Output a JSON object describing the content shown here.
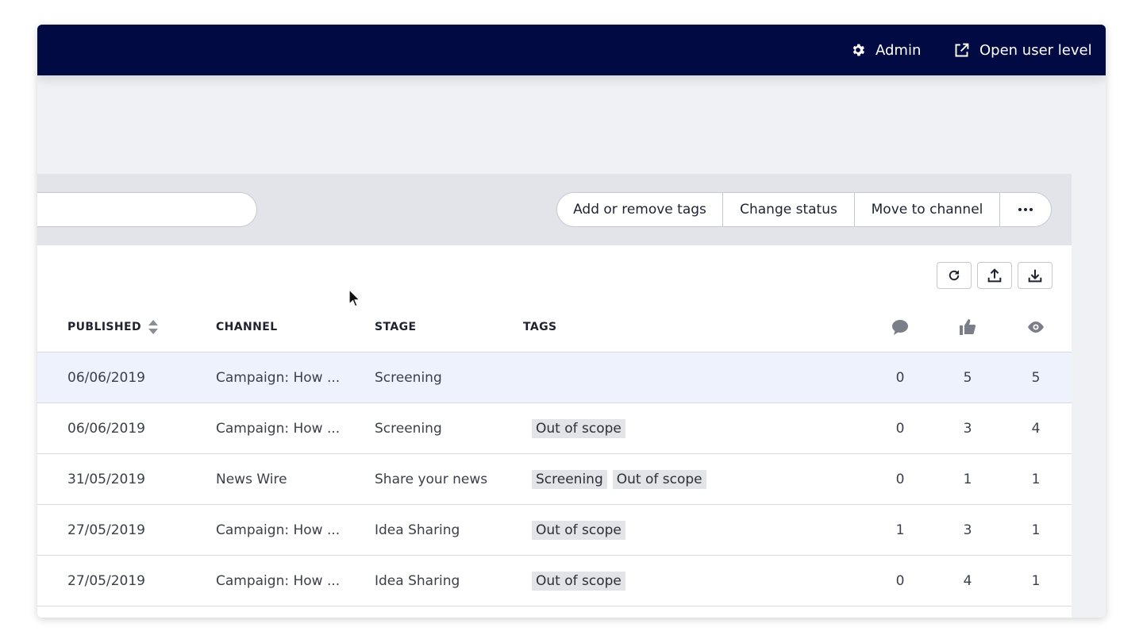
{
  "header": {
    "admin_label": "Admin",
    "open_label": "Open user level"
  },
  "toolbar": {
    "search_placeholder": "",
    "actions": [
      "Add or remove tags",
      "Change status",
      "Move to channel"
    ]
  },
  "table": {
    "columns": {
      "published": "PUBLISHED",
      "channel": "CHANNEL",
      "stage": "STAGE",
      "tags": "TAGS"
    },
    "rows": [
      {
        "date": "06/06/2019",
        "channel": "Campaign: How ...",
        "stage": "Screening",
        "tags": [],
        "comments": "0",
        "likes": "5",
        "views": "5"
      },
      {
        "date": "06/06/2019",
        "channel": "Campaign: How ...",
        "stage": "Screening",
        "tags": [
          "Out of scope"
        ],
        "comments": "0",
        "likes": "3",
        "views": "4"
      },
      {
        "date": "31/05/2019",
        "channel": "News Wire",
        "stage": "Share your news",
        "tags": [
          "Screening",
          "Out of scope"
        ],
        "comments": "0",
        "likes": "1",
        "views": "1"
      },
      {
        "date": "27/05/2019",
        "channel": "Campaign: How ...",
        "stage": "Idea Sharing",
        "tags": [
          "Out of scope"
        ],
        "comments": "1",
        "likes": "3",
        "views": "1"
      },
      {
        "date": "27/05/2019",
        "channel": "Campaign: How ...",
        "stage": "Idea Sharing",
        "tags": [
          "Out of scope"
        ],
        "comments": "0",
        "likes": "4",
        "views": "1"
      }
    ]
  },
  "colors": {
    "topbar": "#020a44",
    "highlight_row": "#eef2fd",
    "tag_bg": "#e3e4e8"
  }
}
